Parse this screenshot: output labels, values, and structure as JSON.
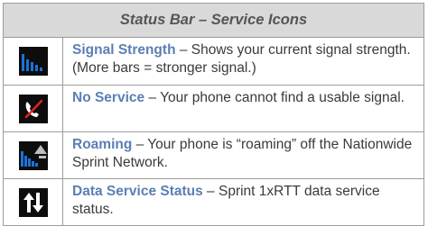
{
  "table": {
    "title": "Status Bar – Service Icons",
    "rows": [
      {
        "icon": "signal-strength-icon",
        "term": "Signal Strength",
        "desc": " – Shows your current signal strength. (More bars = stronger signal.)"
      },
      {
        "icon": "no-service-icon",
        "term": "No Service",
        "desc": " – Your phone cannot find a usable signal."
      },
      {
        "icon": "roaming-icon",
        "term": "Roaming",
        "desc": " – Your phone is “roaming” off the Nationwide Sprint Network."
      },
      {
        "icon": "data-service-icon",
        "term": "Data Service Status",
        "desc": " – Sprint 1xRTT data service status."
      }
    ]
  },
  "colors": {
    "term": "#5a7fb4",
    "header_bg": "#d9d9d9",
    "signal_blue": "#1a73d9"
  }
}
